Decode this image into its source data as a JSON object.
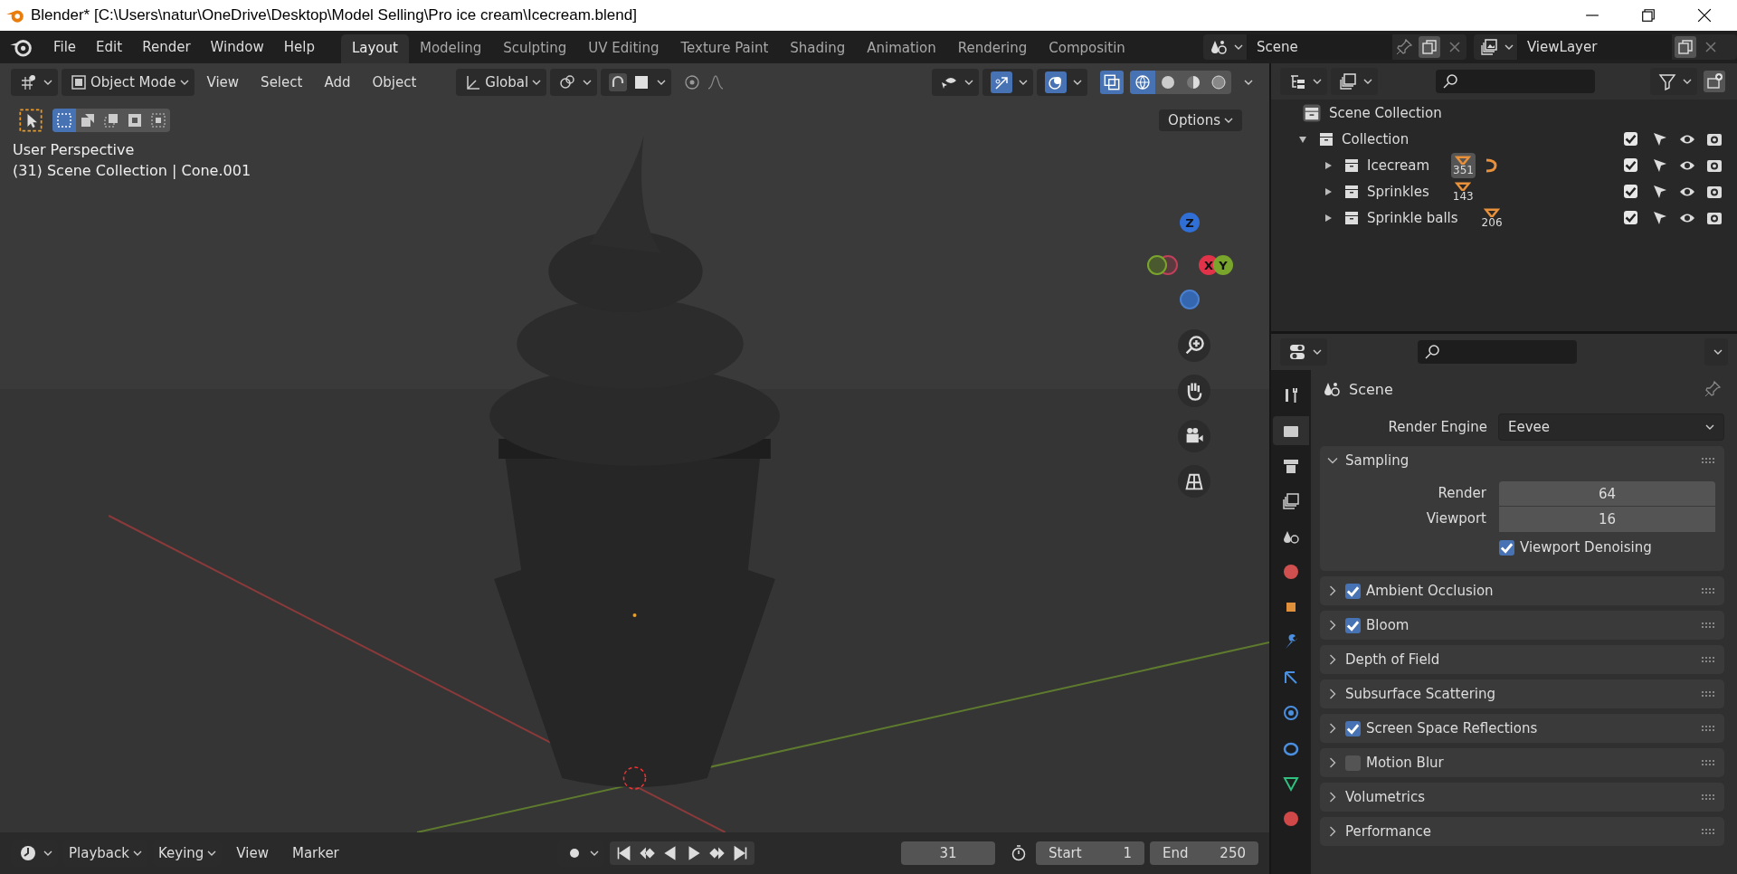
{
  "window": {
    "title": "Blender* [C:\\Users\\natur\\OneDrive\\Desktop\\Model Selling\\Pro ice cream\\Icecream.blend]"
  },
  "menu": [
    "File",
    "Edit",
    "Render",
    "Window",
    "Help"
  ],
  "workspaces": [
    {
      "label": "Layout",
      "selected": true
    },
    {
      "label": "Modeling",
      "selected": false
    },
    {
      "label": "Sculpting",
      "selected": false
    },
    {
      "label": "UV Editing",
      "selected": false
    },
    {
      "label": "Texture Paint",
      "selected": false
    },
    {
      "label": "Shading",
      "selected": false
    },
    {
      "label": "Animation",
      "selected": false
    },
    {
      "label": "Rendering",
      "selected": false
    },
    {
      "label": "Compositin",
      "selected": false
    }
  ],
  "scene": {
    "name": "Scene"
  },
  "view_layer": {
    "name": "ViewLayer"
  },
  "viewport": {
    "mode": "Object Mode",
    "menus": [
      "View",
      "Select",
      "Add",
      "Object"
    ],
    "orientation": "Global",
    "options": "Options",
    "select_modes": [
      {
        "selected": true
      },
      {
        "selected": false
      },
      {
        "selected": false
      },
      {
        "selected": false
      },
      {
        "selected": false
      }
    ],
    "shading_modes": [
      {
        "selected": true
      },
      {
        "selected": false
      },
      {
        "selected": false
      },
      {
        "selected": false
      }
    ],
    "overlay_text": [
      "User Perspective",
      "(31) Scene Collection | Cone.001"
    ],
    "snap": {
      "on": false
    },
    "proportional_edit": {
      "on": false
    },
    "gizmo": [
      {
        "label": "Z",
        "color": "#2f6fd6"
      },
      {
        "label": "X",
        "color": "#e0334a"
      },
      {
        "label": "Y",
        "color": "#7aa52c"
      }
    ]
  },
  "outliner": {
    "root": "Scene Collection",
    "tree": [
      {
        "name": "Collection",
        "expanded": true,
        "checked": true,
        "children": [
          {
            "name": "Icecream",
            "expanded": false,
            "checked": true,
            "count": "351",
            "active": true
          },
          {
            "name": "Sprinkles",
            "expanded": false,
            "checked": true,
            "count": "143",
            "active": false
          },
          {
            "name": "Sprinkle balls",
            "expanded": false,
            "checked": true,
            "count": "206",
            "active": false
          }
        ]
      }
    ]
  },
  "properties": {
    "tabs": [
      {
        "selected": false
      },
      {
        "selected": true
      },
      {
        "selected": false
      },
      {
        "selected": false
      },
      {
        "selected": false
      },
      {
        "selected": false
      },
      {
        "selected": false
      },
      {
        "selected": false
      },
      {
        "selected": false
      },
      {
        "selected": false
      },
      {
        "selected": false
      },
      {
        "selected": false
      },
      {
        "selected": false
      }
    ],
    "context": "Scene",
    "render_engine": {
      "label": "Render Engine",
      "value": "Eevee"
    },
    "panels": [
      {
        "title": "Sampling",
        "kind": "plain",
        "expanded": true,
        "fields": [
          {
            "label": "Render",
            "value": "64"
          },
          {
            "label": "Viewport",
            "value": "16"
          }
        ],
        "option": {
          "label": "Viewport Denoising",
          "checked": true
        }
      },
      {
        "title": "Ambient Occlusion",
        "kind": "toggle",
        "expanded": false,
        "checked": true
      },
      {
        "title": "Bloom",
        "kind": "toggle",
        "expanded": false,
        "checked": true
      },
      {
        "title": "Depth of Field",
        "kind": "plain",
        "expanded": false
      },
      {
        "title": "Subsurface Scattering",
        "kind": "plain",
        "expanded": false
      },
      {
        "title": "Screen Space Reflections",
        "kind": "toggle",
        "expanded": false,
        "checked": true
      },
      {
        "title": "Motion Blur",
        "kind": "toggle",
        "expanded": false,
        "checked": false
      },
      {
        "title": "Volumetrics",
        "kind": "plain",
        "expanded": false
      },
      {
        "title": "Performance",
        "kind": "plain",
        "expanded": false
      }
    ]
  },
  "timeline": {
    "menus": [
      "Playback",
      "Keying",
      "View",
      "Marker"
    ],
    "current_frame": "31",
    "start": {
      "label": "Start",
      "value": "1"
    },
    "end": {
      "label": "End",
      "value": "250"
    }
  }
}
